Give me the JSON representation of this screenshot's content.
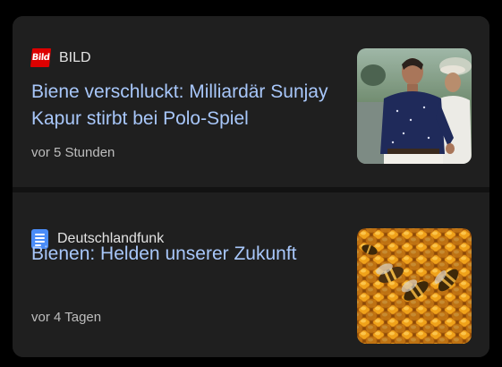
{
  "articles": [
    {
      "source": "BILD",
      "source_logo_text": "Bild",
      "headline": "Biene verschluckt: Milliardär Sunjay Kapur stirbt bei Polo-Spiel",
      "time": "vor 5 Stunden",
      "thumbnail": "photo-man-at-polo-event",
      "logo_color": "#dd0000"
    },
    {
      "source": "Deutschlandfunk",
      "headline": "Bienen: Helden unserer Zukunft",
      "time": "vor 4 Tagen",
      "thumbnail": "photo-bees-on-honeycomb",
      "logo_color": "#4a8cf7"
    }
  ],
  "colors": {
    "card_background": "#1f1f1f",
    "headline": "#a8c7fa",
    "source_text": "#e3e3e3",
    "timestamp": "#bdbdbd"
  }
}
